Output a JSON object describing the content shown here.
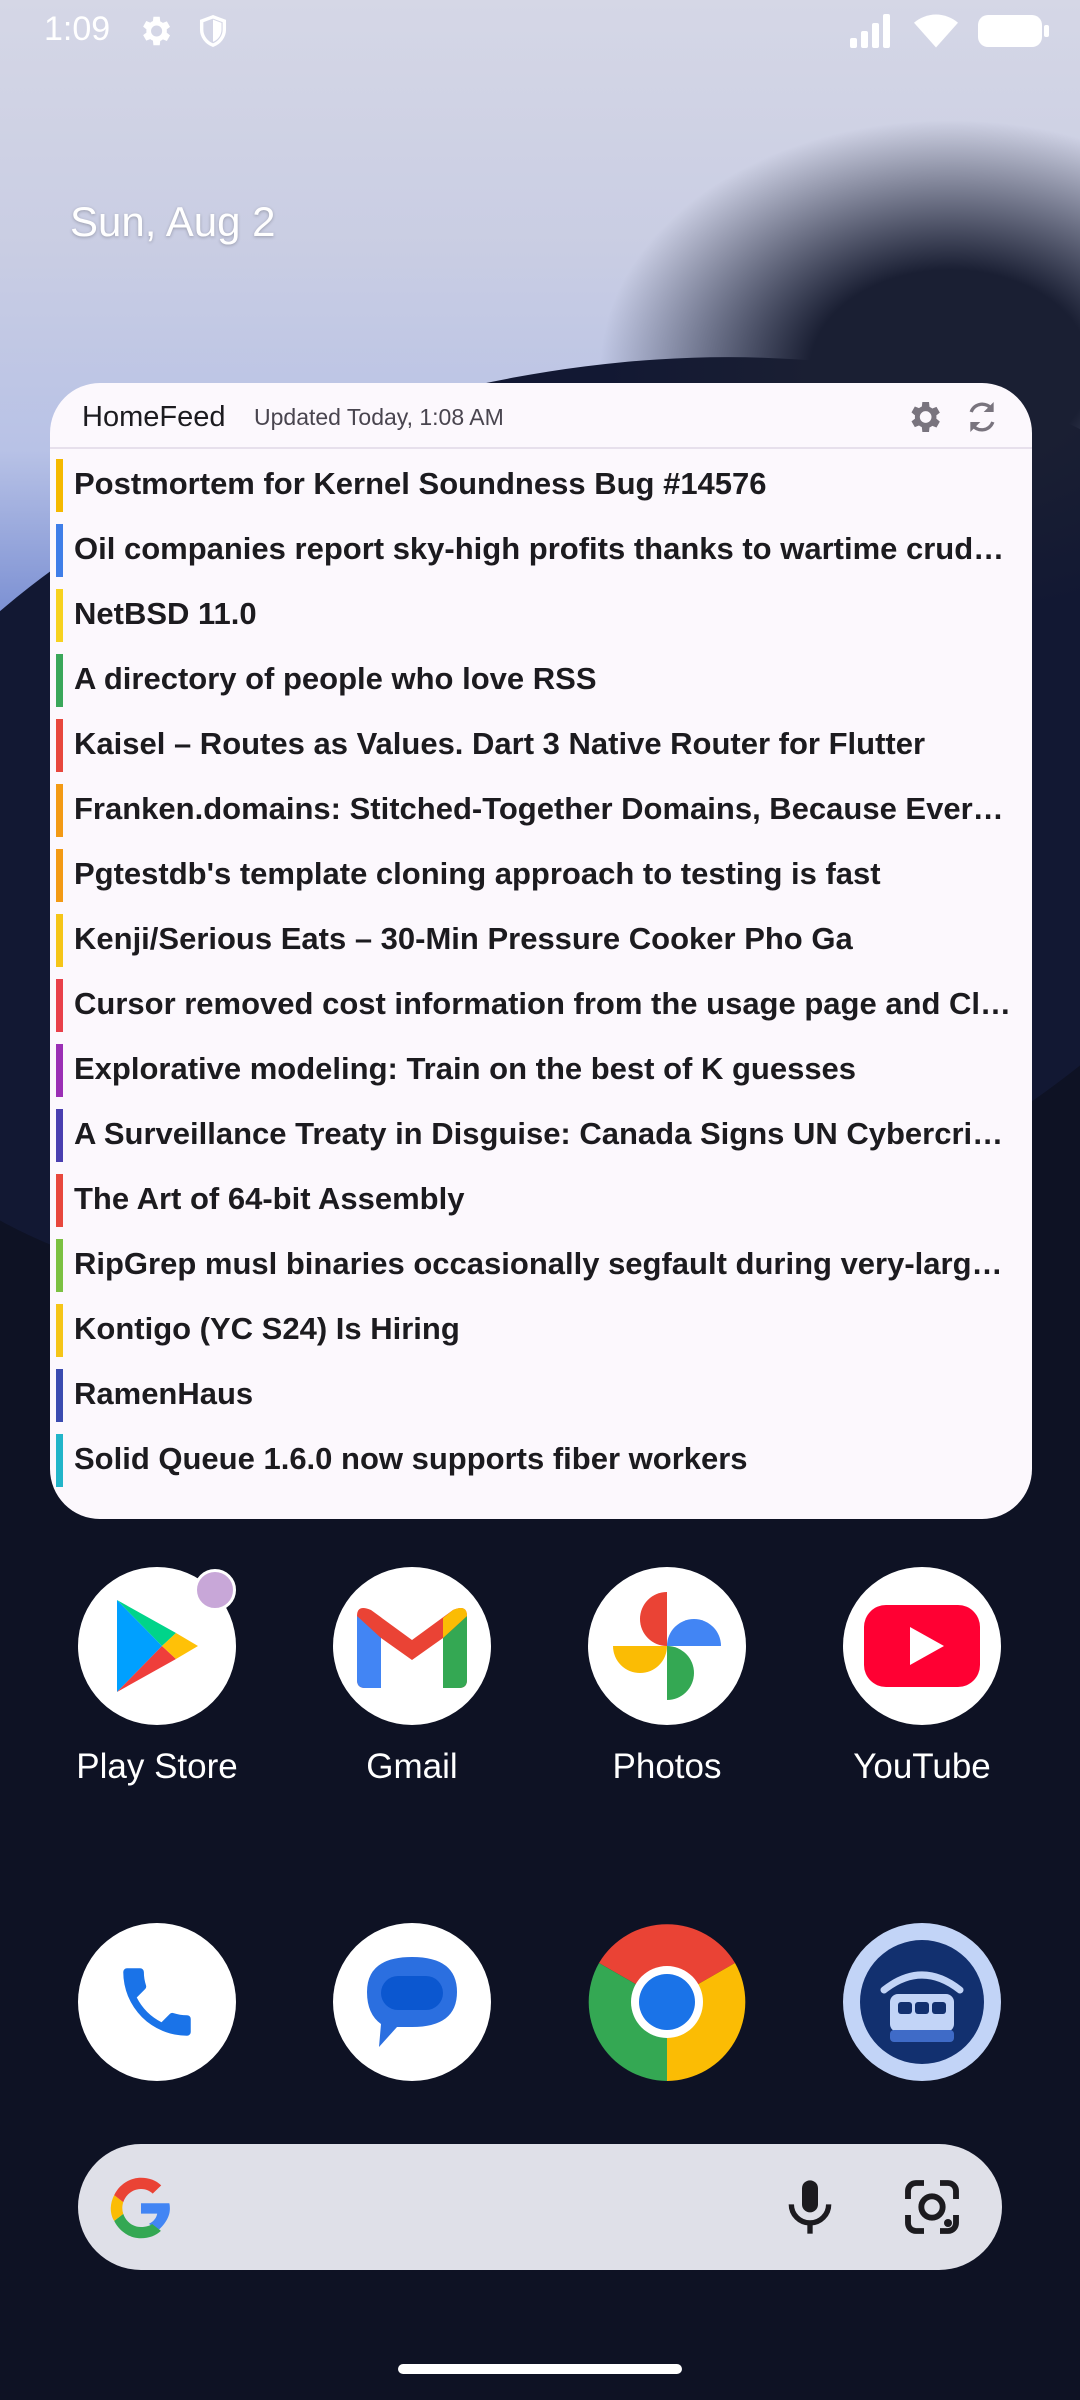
{
  "status_bar": {
    "time": "1:09",
    "icons_left": [
      "settings-icon",
      "shield-icon"
    ],
    "icons_right": [
      "signal-icon",
      "wifi-icon",
      "battery-icon"
    ]
  },
  "date": "Sun, Aug 2",
  "widget": {
    "title": "HomeFeed",
    "updated": "Updated Today, 1:08 AM",
    "items": [
      {
        "title": "Postmortem for Kernel Soundness Bug #14576",
        "color": "#f5b900"
      },
      {
        "title": "Oil companies report sky-high profits thanks to wartime crude price surge",
        "color": "#3f7ee8"
      },
      {
        "title": "NetBSD 11.0",
        "color": "#f7d21f"
      },
      {
        "title": "A directory of people who love RSS",
        "color": "#3aa75a"
      },
      {
        "title": "Kaisel – Routes as Values. Dart 3 Native Router for Flutter",
        "color": "#e8473d"
      },
      {
        "title": "Franken.domains: Stitched-Together Domains, Because Every Word Is Taken",
        "color": "#f39a14"
      },
      {
        "title": "Pgtestdb's template cloning approach to testing is fast",
        "color": "#f39a14"
      },
      {
        "title": "Kenji/Serious Eats – 30-Min Pressure Cooker Pho Ga",
        "color": "#f5c518"
      },
      {
        "title": "Cursor removed cost information from the usage page and Claude Code",
        "color": "#e9404a"
      },
      {
        "title": "Explorative modeling: Train on the best of K guesses",
        "color": "#9b2fb5"
      },
      {
        "title": "A Surveillance Treaty in Disguise: Canada Signs UN Cybercrime Convention",
        "color": "#4a3fb0"
      },
      {
        "title": "The Art of 64-bit Assembly",
        "color": "#e8473d"
      },
      {
        "title": "RipGrep musl binaries occasionally segfault during very-large searches",
        "color": "#7cc142"
      },
      {
        "title": "Kontigo (YC S24) Is Hiring",
        "color": "#f5c518"
      },
      {
        "title": "RamenHaus",
        "color": "#3b4bb0"
      },
      {
        "title": "Solid Queue 1.6.0 now supports fiber workers",
        "color": "#22b5c9"
      }
    ]
  },
  "apps_row1": [
    {
      "label": "Play Store",
      "icon": "play-store-icon"
    },
    {
      "label": "Gmail",
      "icon": "gmail-icon"
    },
    {
      "label": "Photos",
      "icon": "photos-icon"
    },
    {
      "label": "YouTube",
      "icon": "youtube-icon"
    }
  ],
  "dock": [
    {
      "icon": "phone-icon"
    },
    {
      "icon": "messages-icon"
    },
    {
      "icon": "chrome-icon"
    },
    {
      "icon": "homefeed-app-icon"
    }
  ],
  "search": {
    "icon_left": "google-g-icon",
    "icon_mic": "mic-icon",
    "icon_lens": "lens-icon"
  }
}
